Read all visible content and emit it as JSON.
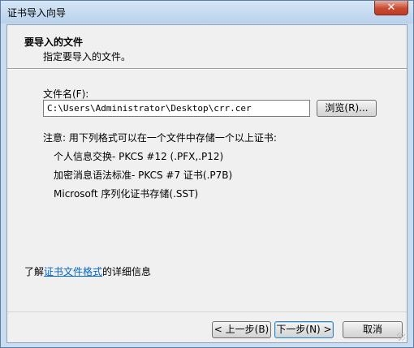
{
  "window": {
    "title": "证书导入向导",
    "close_glyph": "✕"
  },
  "header": {
    "title": "要导入的文件",
    "subtitle": "指定要导入的文件。"
  },
  "file": {
    "label": "文件名(F):",
    "value": "C:\\Users\\Administrator\\Desktop\\crr.cer",
    "browse_label": "浏览(R)..."
  },
  "note": {
    "text": "注意: 用下列格式可以在一个文件中存储一个以上证书:",
    "formats": [
      "个人信息交换- PKCS #12 (.PFX,.P12)",
      "加密消息语法标准- PKCS #7 证书(.P7B)",
      "Microsoft 序列化证书存储(.SST)"
    ]
  },
  "more_info": {
    "prefix": "了解",
    "link": "证书文件格式",
    "suffix": "的详细信息"
  },
  "buttons": {
    "back": "< 上一步(B)",
    "next": "下一步(N) >",
    "cancel": "取消"
  }
}
